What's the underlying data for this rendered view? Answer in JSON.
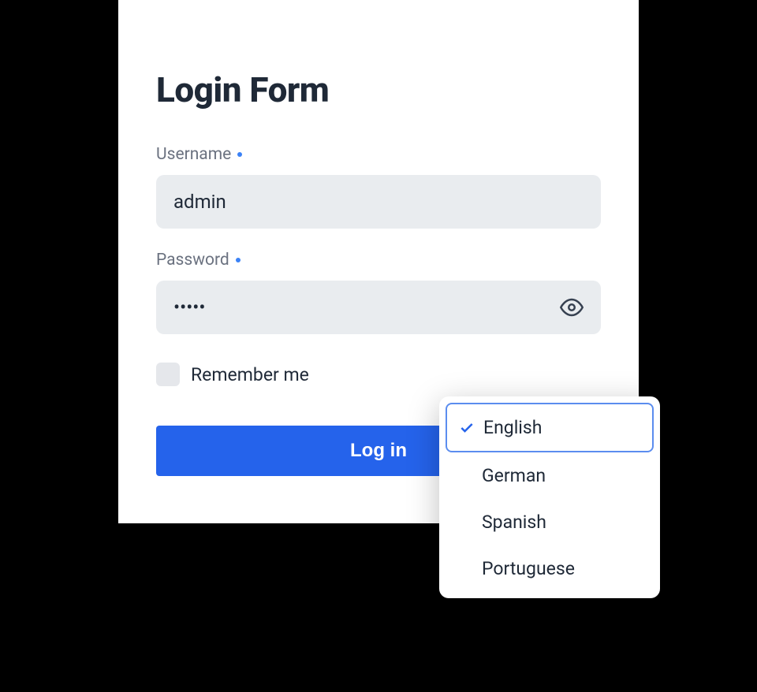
{
  "form": {
    "title": "Login Form",
    "username": {
      "label": "Username",
      "value": "admin"
    },
    "password": {
      "label": "Password",
      "value": "•••••"
    },
    "remember": {
      "label": "Remember me",
      "checked": false
    },
    "submit": {
      "label": "Log in"
    }
  },
  "language_dropdown": {
    "selected": "English",
    "options": [
      "English",
      "German",
      "Spanish",
      "Portuguese"
    ]
  },
  "colors": {
    "primary": "#2563eb",
    "input_bg": "#e9ecef",
    "text": "#1f2937",
    "label": "#6b7280"
  }
}
